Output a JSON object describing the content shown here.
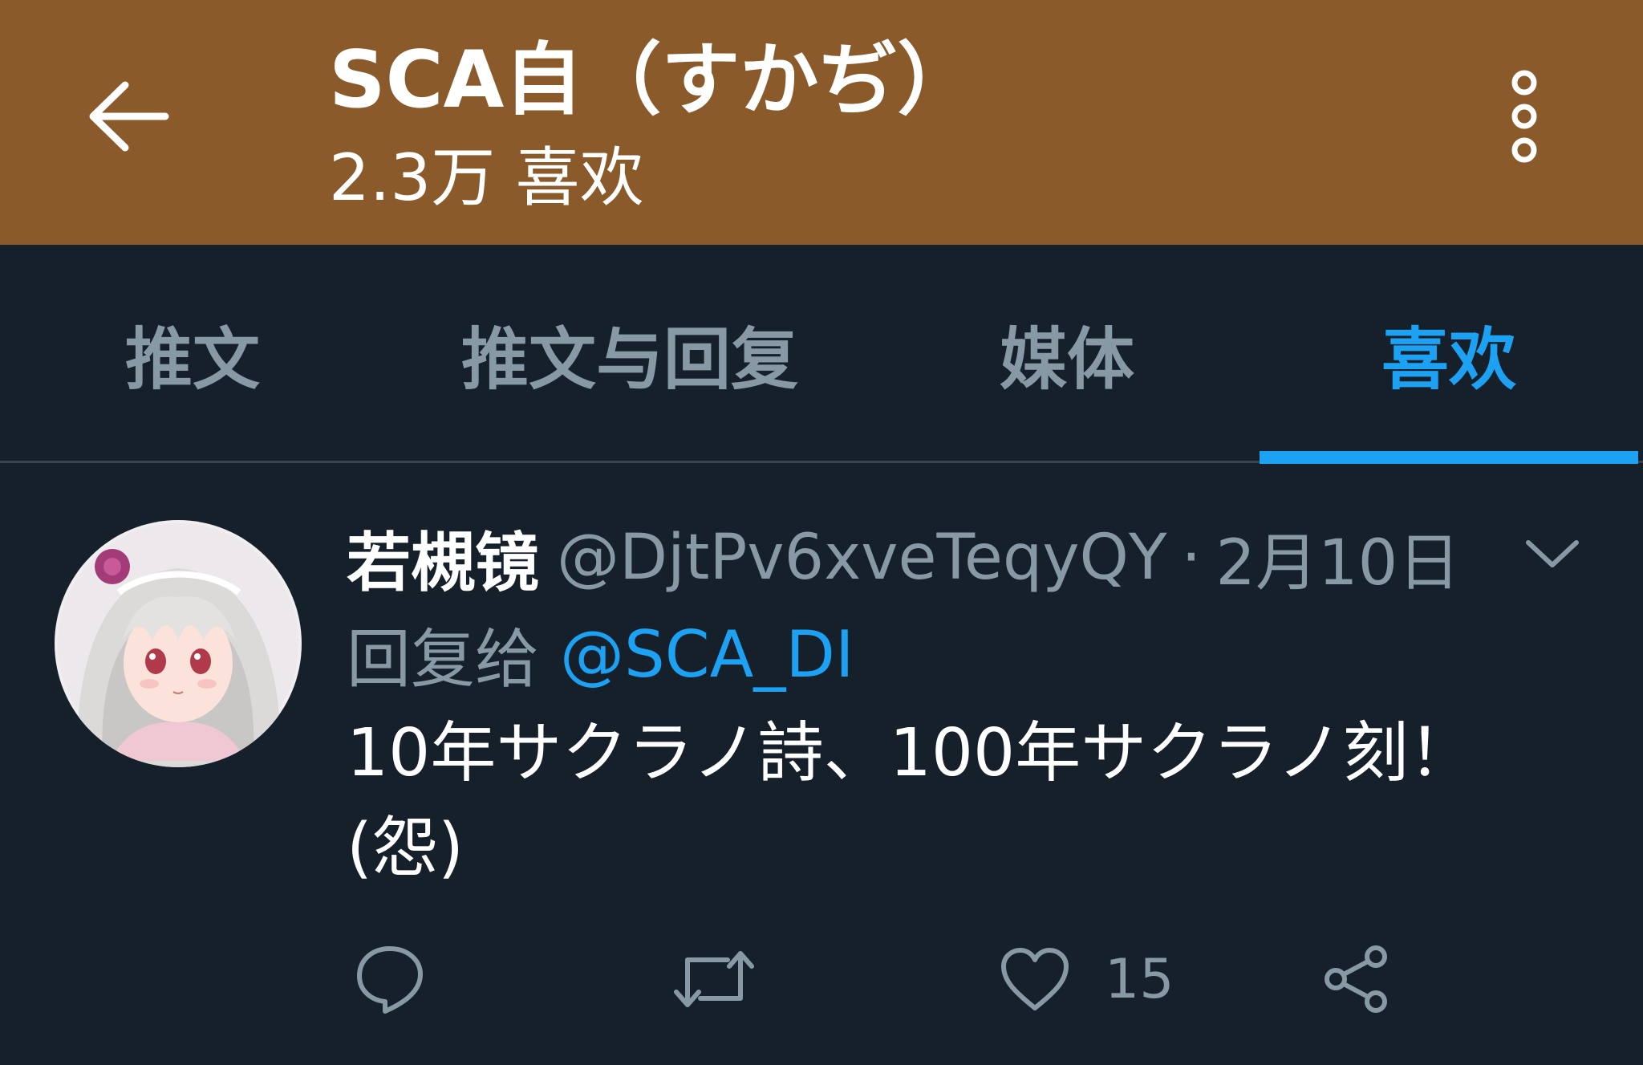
{
  "colors": {
    "header_bg": "#8b5a2b",
    "page_bg": "#15202b",
    "accent": "#1da1f2",
    "muted": "#8899a6",
    "divider": "#38444d"
  },
  "header": {
    "back_icon": "arrow-left-icon",
    "title": "SCA自（すかぢ）",
    "subtitle": "2.3万 喜欢",
    "menu_icon": "more-vertical-icon"
  },
  "tabs": [
    {
      "label": "推文",
      "active": false
    },
    {
      "label": "推文与回复",
      "active": false
    },
    {
      "label": "媒体",
      "active": false
    },
    {
      "label": "喜欢",
      "active": true
    }
  ],
  "tweet": {
    "author_name": "若槻镜",
    "handle": "@DjtPv6xveTeqyQY",
    "separator": "·",
    "date": "2月10日",
    "caret_icon": "chevron-down-icon",
    "reply_prefix": "回复给",
    "reply_to": "@SCA_DI",
    "text": "10年サクラノ詩、100年サクラノ刻！(怨)",
    "actions": {
      "reply_icon": "comment-icon",
      "retweet_icon": "retweet-icon",
      "like_icon": "heart-icon",
      "like_count": "15",
      "share_icon": "share-icon"
    }
  }
}
